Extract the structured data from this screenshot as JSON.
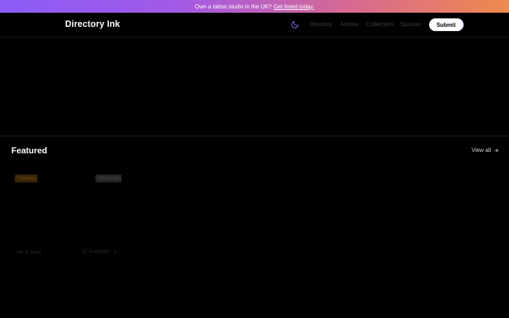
{
  "banner": {
    "text": "Own a tattoo studio in the UK?",
    "link": "Get listed today."
  },
  "header": {
    "logo": "Directory Ink",
    "theme_icon": "moon-icon",
    "nav": [
      "Directory",
      "Articles",
      "Collections",
      "Sponsor"
    ],
    "submit_label": "Submit"
  },
  "featured": {
    "title": "Featured",
    "view_all": "View all",
    "cards": [
      {
        "badge": "Featured",
        "name": "Ink & Soul"
      },
      {
        "badge": "Sponsored",
        "location": "liverpool"
      }
    ]
  },
  "colors": {
    "background": "#000000",
    "banner_gradient": [
      "#8b5cf6",
      "#d96a8e",
      "#ee8a4e"
    ],
    "submit_bg": "#ffffff",
    "featured_badge_bg": "#3a2608",
    "sponsored_badge_bg": "#262626"
  }
}
